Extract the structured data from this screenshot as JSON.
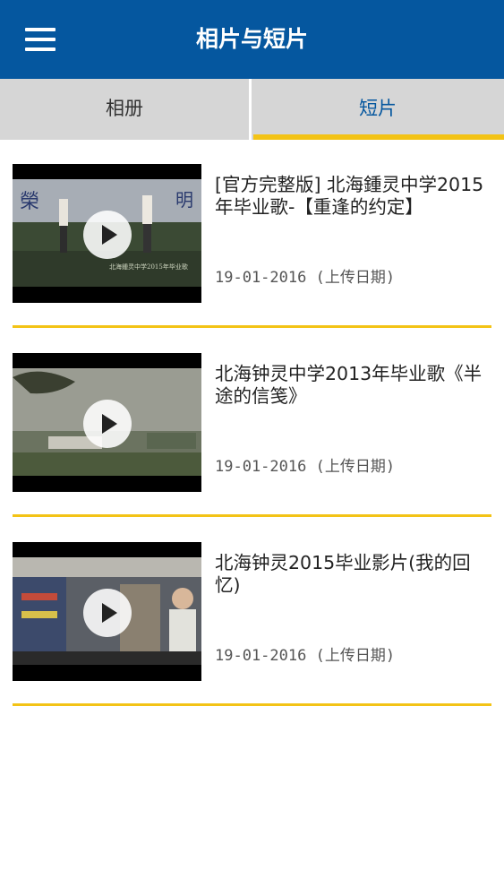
{
  "header": {
    "title": "相片与短片",
    "menu_icon": "hamburger-menu-icon"
  },
  "tabs": [
    {
      "label": "相册",
      "active": false
    },
    {
      "label": "短片",
      "active": true
    }
  ],
  "colors": {
    "header_bg": "#05579f",
    "accent": "#f3c316",
    "tab_bg": "#d6d6d6",
    "active_tab_text": "#05579f"
  },
  "videos": [
    {
      "title": "[官方完整版] 北海鍾灵中学2015年毕业歌-【重逢的约定】",
      "date": "19-01-2016 (上传日期)",
      "play_icon": "play-icon"
    },
    {
      "title": "北海钟灵中学2013年毕业歌《半途的信笺》",
      "date": "19-01-2016 (上传日期)",
      "play_icon": "play-icon"
    },
    {
      "title": "北海钟灵2015毕业影片(我的回忆)",
      "date": "19-01-2016 (上传日期)",
      "play_icon": "play-icon"
    }
  ]
}
